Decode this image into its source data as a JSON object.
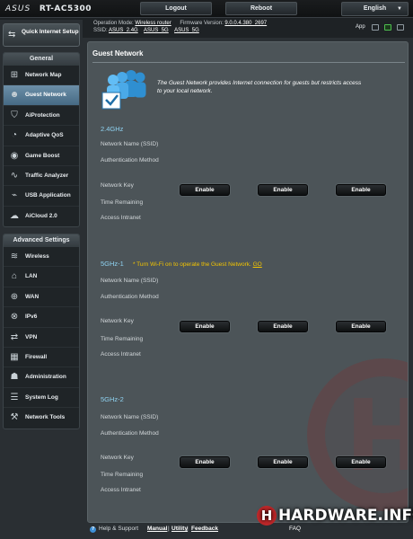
{
  "brand": {
    "logo": "ASUS",
    "model": "RT-AC5300"
  },
  "topbar": {
    "logout": "Logout",
    "reboot": "Reboot",
    "language": "English"
  },
  "info": {
    "op_mode_label": "Operation Mode:",
    "op_mode_value": "Wireless router",
    "firmware_label": "Firmware Version:",
    "firmware_value": "9.0.0.4.380_2697",
    "ssid_label": "SSID:",
    "ssid_1": "ASUS_2.4G",
    "ssid_2": "ASUS_5G",
    "ssid_3": "ASUS_5G",
    "app_label": "App"
  },
  "sidebar": {
    "quick_setup": "Quick Internet Setup",
    "general_header": "General",
    "general_items": [
      {
        "label": "Network Map",
        "icon": "network-map-icon"
      },
      {
        "label": "Guest Network",
        "icon": "guest-network-icon"
      },
      {
        "label": "AiProtection",
        "icon": "aiprotection-icon"
      },
      {
        "label": "Adaptive QoS",
        "icon": "qos-gauge-icon"
      },
      {
        "label": "Game Boost",
        "icon": "gamepad-icon"
      },
      {
        "label": "Traffic Analyzer",
        "icon": "traffic-chart-icon"
      },
      {
        "label": "USB Application",
        "icon": "usb-icon"
      },
      {
        "label": "AiCloud 2.0",
        "icon": "cloud-icon"
      }
    ],
    "advanced_header": "Advanced Settings",
    "advanced_items": [
      {
        "label": "Wireless",
        "icon": "wireless-icon"
      },
      {
        "label": "LAN",
        "icon": "lan-icon"
      },
      {
        "label": "WAN",
        "icon": "wan-globe-icon"
      },
      {
        "label": "IPv6",
        "icon": "ipv6-icon"
      },
      {
        "label": "VPN",
        "icon": "vpn-icon"
      },
      {
        "label": "Firewall",
        "icon": "firewall-icon"
      },
      {
        "label": "Administration",
        "icon": "administration-icon"
      },
      {
        "label": "System Log",
        "icon": "system-log-icon"
      },
      {
        "label": "Network Tools",
        "icon": "network-tools-icon"
      }
    ],
    "active_item": "Guest Network"
  },
  "main": {
    "title": "Guest Network",
    "intro": "The Guest Network provides Internet connection for guests but restricts access to your local network.",
    "field_labels": {
      "ssid": "Network Name (SSID)",
      "auth": "Authentication Method",
      "key": "Network Key",
      "time": "Time Remaining",
      "access": "Access Intranet"
    },
    "bands": [
      {
        "title": "2.4GHz",
        "warning": "",
        "go": ""
      },
      {
        "title": "5GHz-1",
        "warning": "* Turn Wi-Fi on to operate the Guest Network.",
        "go": "GO"
      },
      {
        "title": "5GHz-2",
        "warning": "",
        "go": ""
      }
    ],
    "enable_label": "Enable"
  },
  "footer": {
    "help": "Help & Support",
    "manual": "Manual",
    "utility": "Utility",
    "feedback": "Feedback",
    "faq": "FAQ"
  },
  "watermark": "HARDWARE.INFO"
}
